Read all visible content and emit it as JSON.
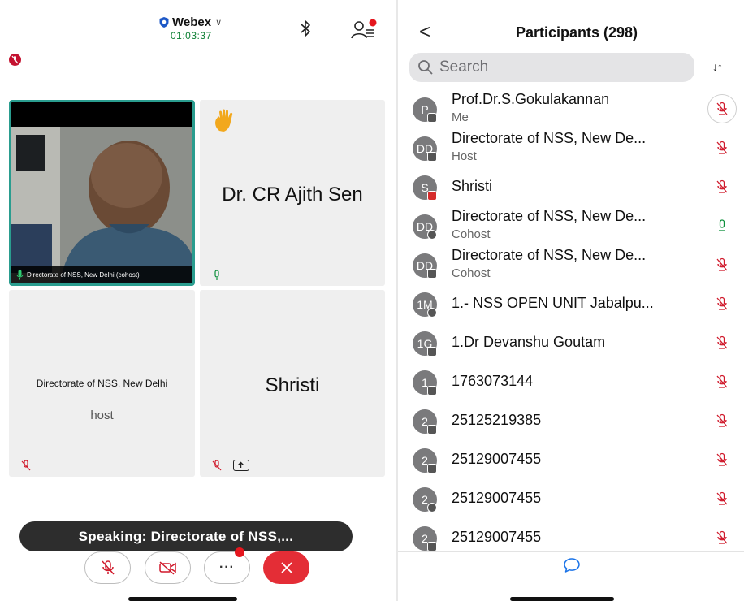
{
  "meeting": {
    "top_cut_text": "",
    "app_name": "Webex",
    "timer": "01:03:37"
  },
  "tiles": {
    "video_caption": "Directorate of NSS, New Delhi (cohost)",
    "hand_name": "Dr. CR Ajith Sen",
    "host_name": "Directorate of NSS, New Delhi",
    "host_role": "host",
    "shristi_name": "Shristi"
  },
  "speaking_banner": "Speaking: Directorate of NSS,...",
  "controls": {
    "more_label": "···"
  },
  "participants": {
    "title": "Participants (298)",
    "back_label": "<",
    "search_placeholder": "Search",
    "sort_label": "↓↑",
    "list": [
      {
        "initials": "P",
        "name": "Prof.Dr.S.Gokulakannan",
        "role": "Me",
        "badge": "phone",
        "mic": "muted-circled"
      },
      {
        "initials": "DD",
        "name": "Directorate of NSS, New De...",
        "role": "Host",
        "badge": "phone",
        "mic": "muted"
      },
      {
        "initials": "S",
        "name": "Shristi",
        "role": "",
        "badge": "share",
        "mic": "muted"
      },
      {
        "initials": "DD",
        "name": "Directorate of NSS, New De...",
        "role": "Cohost",
        "badge": "sync",
        "mic": "unmuted"
      },
      {
        "initials": "DD",
        "name": "Directorate of NSS, New De...",
        "role": "Cohost",
        "badge": "phone",
        "mic": "muted"
      },
      {
        "initials": "1M",
        "name": "1.- NSS OPEN UNIT Jabalpu...",
        "role": "",
        "badge": "sync",
        "mic": "muted"
      },
      {
        "initials": "1G",
        "name": "1.Dr Devanshu Goutam",
        "role": "",
        "badge": "phone",
        "mic": "muted"
      },
      {
        "initials": "1",
        "name": "1763073144",
        "role": "",
        "badge": "phone",
        "mic": "muted"
      },
      {
        "initials": "2",
        "name": "25125219385",
        "role": "",
        "badge": "phone",
        "mic": "muted"
      },
      {
        "initials": "2",
        "name": "25129007455",
        "role": "",
        "badge": "phone",
        "mic": "muted"
      },
      {
        "initials": "2",
        "name": "25129007455",
        "role": "",
        "badge": "sync",
        "mic": "muted"
      },
      {
        "initials": "2",
        "name": "25129007455",
        "role": "",
        "badge": "phone",
        "mic": "muted"
      }
    ]
  },
  "colors": {
    "muted_red": "#d0192b",
    "unmuted_green": "#0b8f3a",
    "end_call_red": "#e42d36",
    "active_tile_border": "#2a9d8f",
    "avatar_gray": "#7a7a7c",
    "chat_blue": "#1a73e8"
  },
  "icons": [
    "shield-icon",
    "chevron-down-icon",
    "bluetooth-icon",
    "participants-icon",
    "hand-raised-icon",
    "mic-icon",
    "mic-muted-icon",
    "share-screen-icon",
    "video-off-icon",
    "more-icon",
    "close-icon",
    "search-icon",
    "sort-icon",
    "chat-icon",
    "back-chevron-icon"
  ]
}
